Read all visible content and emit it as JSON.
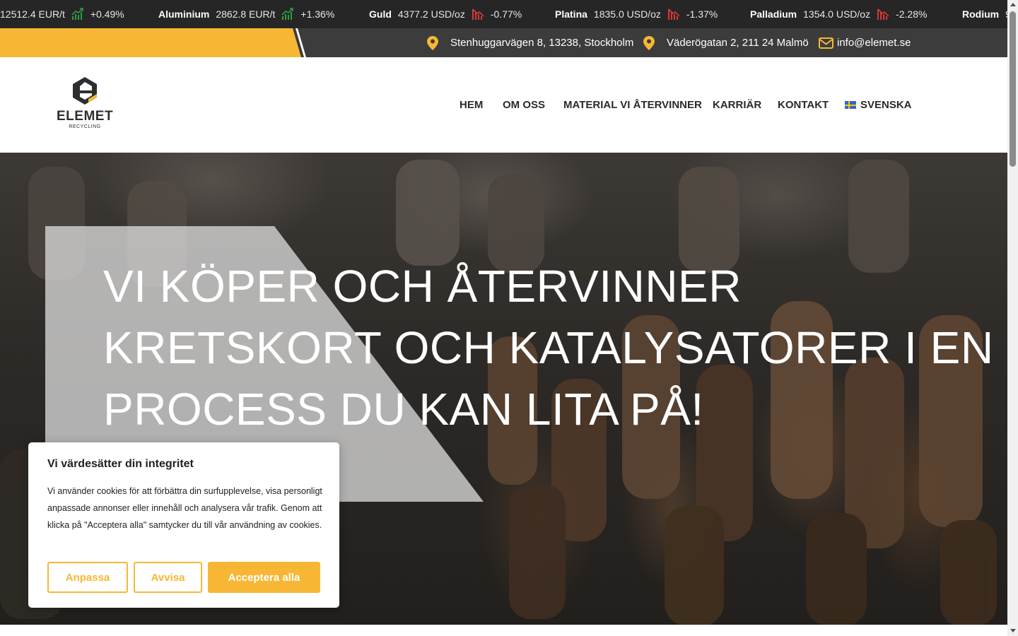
{
  "colors": {
    "accent": "#f7b735",
    "ticker_bg": "#262626",
    "topbar_bg": "#3c3c3c",
    "up": "#2e9e44",
    "down": "#d93a3a"
  },
  "ticker": [
    {
      "name": "",
      "price": "12512.4 EUR/t",
      "change": "+0.49%",
      "trend": "up"
    },
    {
      "name": "Aluminium",
      "price": "2862.8 EUR/t",
      "change": "+1.36%",
      "trend": "up"
    },
    {
      "name": "Guld",
      "price": "4377.2 USD/oz",
      "change": "-0.77%",
      "trend": "down"
    },
    {
      "name": "Platina",
      "price": "1835.0 USD/oz",
      "change": "-1.37%",
      "trend": "down"
    },
    {
      "name": "Palladium",
      "price": "1354.0 USD/oz",
      "change": "-2.28%",
      "trend": "down"
    },
    {
      "name": "Rodium",
      "price": "9",
      "change": "",
      "trend": ""
    }
  ],
  "topbar": {
    "address_1": "Stenhuggarvägen 8, 13238, Stockholm",
    "address_2": "Väderögatan 2, 211 24 Malmö",
    "email": "info@elemet.se",
    "icons": [
      "map-pin-icon",
      "map-pin-icon",
      "mail-icon"
    ]
  },
  "logo": {
    "word": "ELEMET",
    "sub": "RECYCLING"
  },
  "nav": {
    "items": [
      "HEM",
      "OM OSS",
      "MATERIAL VI ÅTERVINNER",
      "KARRIÄR",
      "KONTAKT"
    ],
    "language": "SVENSKA",
    "language_icon": "swedish-flag-icon"
  },
  "hero": {
    "lines": [
      "VI KÖPER OCH ÅTERVINNER",
      "KRETSKORT OCH KATALYSATORER I EN",
      "PROCESS DU KAN LITA PÅ!"
    ]
  },
  "cookie": {
    "title": "Vi värdesätter din integritet",
    "text": "Vi använder cookies för att förbättra din surfupplevelse, visa personligt anpassade annonser eller innehåll och analysera vår trafik. Genom att klicka på \"Acceptera alla\" samtycker du till vår användning av cookies.",
    "customize": "Anpassa",
    "reject": "Avvisa",
    "accept": "Acceptera alla"
  }
}
